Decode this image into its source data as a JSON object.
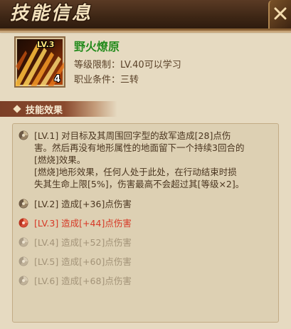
{
  "header": {
    "title": "技能信息"
  },
  "skill": {
    "level_badge": "LV.3",
    "count_badge": "4",
    "name": "野火燎原",
    "level_requirement": "等级限制：LV.40可以学习",
    "job_requirement": "职业条件：三转"
  },
  "section": {
    "label": "技能效果"
  },
  "levels": [
    {
      "label": "[LV.1]",
      "text_lines": [
        "[LV.1] 对目标及其周围回字型的敌军造成[28]点伤",
        "害。然后再没有地形属性的地面留下一个持续3回合的",
        "[燃烧]效果。",
        "[燃烧]地形效果，任何人处于此处，在行动结束时损",
        "失其生命上限[5%]，伤害最高不会超过其[等级×2]。"
      ]
    },
    {
      "text": "[LV.2] 造成[+36]点伤害",
      "state": "unlocked"
    },
    {
      "text": "[LV.3] 造成[+44]点伤害",
      "state": "current"
    },
    {
      "text": "[LV.4] 造成[+52]点伤害",
      "state": "locked"
    },
    {
      "text": "[LV.5] 造成[+60]点伤害",
      "state": "locked"
    },
    {
      "text": "[LV.6] 造成[+68]点伤害",
      "state": "locked"
    }
  ],
  "icons": {
    "close": "close-icon",
    "level_marker": "swirl-icon"
  },
  "colors": {
    "name_green": "#258a1c",
    "current_red": "#d63826",
    "locked_gray": "#a39378",
    "text_brown": "#4b3620"
  }
}
